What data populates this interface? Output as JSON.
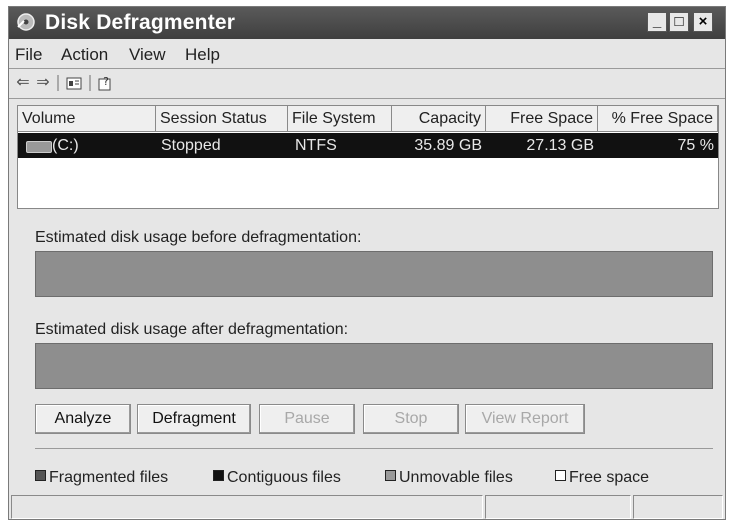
{
  "window": {
    "title": "Disk Defragmenter",
    "controls": {
      "minimize": "_",
      "maximize": "□",
      "close": "×"
    }
  },
  "menu": {
    "items": [
      "File",
      "Action",
      "View",
      "Help"
    ]
  },
  "toolbar": {
    "icons": [
      "back-arrow-icon",
      "forward-arrow-icon",
      "properties-icon",
      "help-icon"
    ]
  },
  "volumes": {
    "columns": [
      "Volume",
      "Session Status",
      "File System",
      "Capacity",
      "Free Space",
      "% Free Space"
    ],
    "rows": [
      {
        "volume": "(C:)",
        "status": "Stopped",
        "file_system": "NTFS",
        "capacity": "35.89 GB",
        "free_space": "27.13 GB",
        "pct_free": "75 %"
      }
    ]
  },
  "analysis": {
    "before_label": "Estimated disk usage before defragmentation:",
    "after_label": "Estimated disk usage after defragmentation:"
  },
  "buttons": {
    "analyze": "Analyze",
    "defragment": "Defragment",
    "pause": "Pause",
    "stop": "Stop",
    "view_report": "View Report"
  },
  "legend": {
    "fragmented": "Fragmented files",
    "contiguous": "Contiguous files",
    "unmovable": "Unmovable files",
    "free": "Free space"
  },
  "colors": {
    "fragmented": "#555555",
    "contiguous": "#111111",
    "unmovable": "#9a9a9a",
    "free": "#ffffff",
    "usage_bar": "#8e8e8e"
  }
}
